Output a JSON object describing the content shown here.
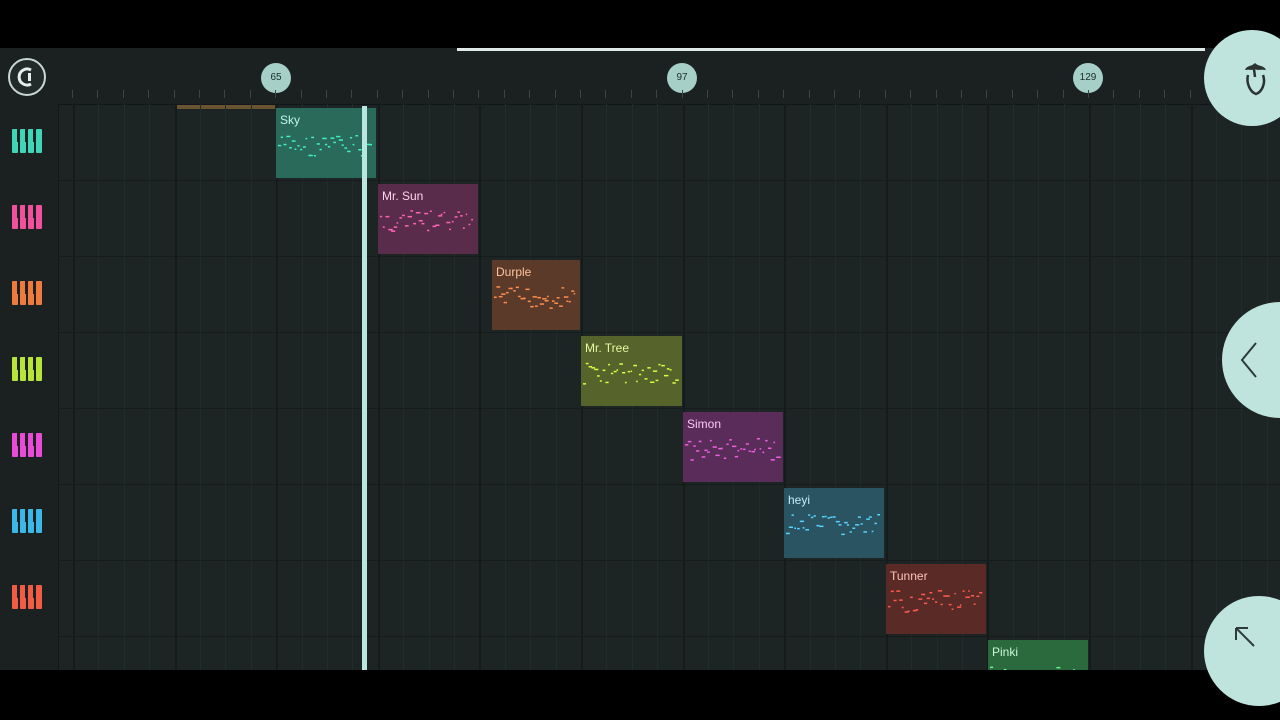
{
  "timeline": {
    "markers": [
      {
        "label": "65"
      },
      {
        "label": "97"
      },
      {
        "label": "129"
      }
    ]
  },
  "tracks": [
    {
      "color": "#3fd6b8"
    },
    {
      "color": "#f0509c"
    },
    {
      "color": "#ef7a3e"
    },
    {
      "color": "#b7e43a"
    },
    {
      "color": "#e94ad6"
    },
    {
      "color": "#3bb7e8"
    },
    {
      "color": "#f25c45"
    }
  ],
  "clips": [
    {
      "name": "Sky",
      "bg": "#2a6a5a",
      "text": "#bff5e6",
      "note": "#3ff0c4"
    },
    {
      "name": "Mr. Sun",
      "bg": "#5a2c4b",
      "text": "#ffd2ea",
      "note": "#ff63b3"
    },
    {
      "name": "Durple",
      "bg": "#5b3a2a",
      "text": "#ffc39e",
      "note": "#ff8d4c"
    },
    {
      "name": "Mr. Tree",
      "bg": "#56632a",
      "text": "#eaf7a3",
      "note": "#d6ff45"
    },
    {
      "name": "Simon",
      "bg": "#5a2c5a",
      "text": "#ffc6f5",
      "note": "#f05ee2"
    },
    {
      "name": "heyi",
      "bg": "#2b5462",
      "text": "#c6ecfa",
      "note": "#57d3ff"
    },
    {
      "name": "Tunner",
      "bg": "#5a2a27",
      "text": "#ffc2b7",
      "note": "#ff5a4d"
    },
    {
      "name": "Pinki",
      "bg": "#2a6a3c",
      "text": "#c8f7d3",
      "note": "#6ef28e"
    }
  ]
}
